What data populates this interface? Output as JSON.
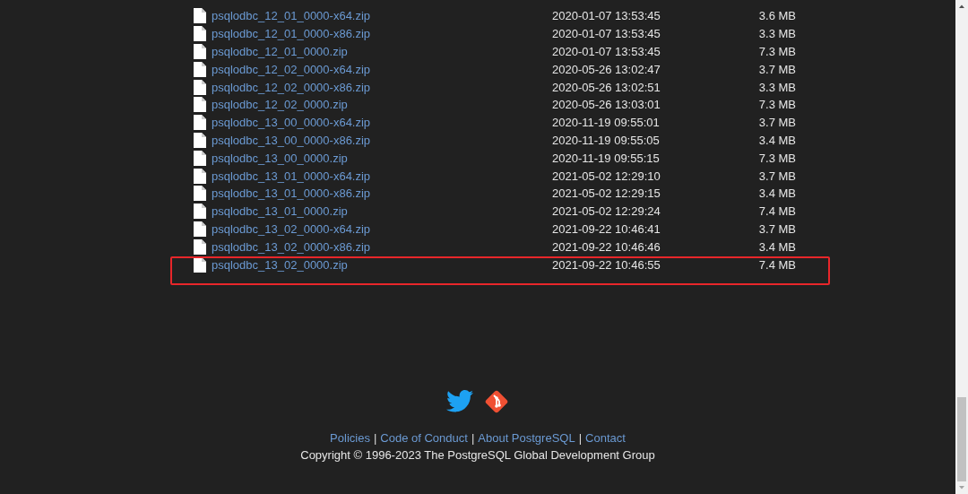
{
  "files": [
    {
      "name": "psqlodbc_12_01_0000-x64.zip",
      "modified": "2020-01-07 13:53:45",
      "size": "3.6 MB",
      "highlighted": false
    },
    {
      "name": "psqlodbc_12_01_0000-x86.zip",
      "modified": "2020-01-07 13:53:45",
      "size": "3.3 MB",
      "highlighted": false
    },
    {
      "name": "psqlodbc_12_01_0000.zip",
      "modified": "2020-01-07 13:53:45",
      "size": "7.3 MB",
      "highlighted": false
    },
    {
      "name": "psqlodbc_12_02_0000-x64.zip",
      "modified": "2020-05-26 13:02:47",
      "size": "3.7 MB",
      "highlighted": false
    },
    {
      "name": "psqlodbc_12_02_0000-x86.zip",
      "modified": "2020-05-26 13:02:51",
      "size": "3.3 MB",
      "highlighted": false
    },
    {
      "name": "psqlodbc_12_02_0000.zip",
      "modified": "2020-05-26 13:03:01",
      "size": "7.3 MB",
      "highlighted": false
    },
    {
      "name": "psqlodbc_13_00_0000-x64.zip",
      "modified": "2020-11-19 09:55:01",
      "size": "3.7 MB",
      "highlighted": false
    },
    {
      "name": "psqlodbc_13_00_0000-x86.zip",
      "modified": "2020-11-19 09:55:05",
      "size": "3.4 MB",
      "highlighted": false
    },
    {
      "name": "psqlodbc_13_00_0000.zip",
      "modified": "2020-11-19 09:55:15",
      "size": "7.3 MB",
      "highlighted": false
    },
    {
      "name": "psqlodbc_13_01_0000-x64.zip",
      "modified": "2021-05-02 12:29:10",
      "size": "3.7 MB",
      "highlighted": false
    },
    {
      "name": "psqlodbc_13_01_0000-x86.zip",
      "modified": "2021-05-02 12:29:15",
      "size": "3.4 MB",
      "highlighted": false
    },
    {
      "name": "psqlodbc_13_01_0000.zip",
      "modified": "2021-05-02 12:29:24",
      "size": "7.4 MB",
      "highlighted": false
    },
    {
      "name": "psqlodbc_13_02_0000-x64.zip",
      "modified": "2021-09-22 10:46:41",
      "size": "3.7 MB",
      "highlighted": false
    },
    {
      "name": "psqlodbc_13_02_0000-x86.zip",
      "modified": "2021-09-22 10:46:46",
      "size": "3.4 MB",
      "highlighted": false
    },
    {
      "name": "psqlodbc_13_02_0000.zip",
      "modified": "2021-09-22 10:46:55",
      "size": "7.4 MB",
      "highlighted": true
    }
  ],
  "footer": {
    "links": [
      "Policies",
      "Code of Conduct",
      "About PostgreSQL",
      "Contact"
    ],
    "separator": "|",
    "copyright": "Copyright © 1996-2023 The PostgreSQL Global Development Group"
  }
}
